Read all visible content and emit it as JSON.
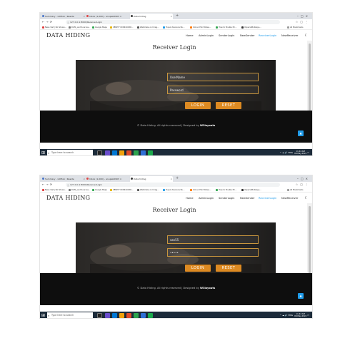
{
  "browser": {
    "tabs": [
      {
        "title": "Inbox (1,000) - anupak0903 ×"
      },
      {
        "title": "Data hiding"
      }
    ],
    "first_tab_title": "Summary - GitHub / Reside",
    "url": "127.0.0.1:8000/ReceiverLogin",
    "bookmarks": [
      {
        "label": "New chat | No Shown...",
        "color": "#e03b3b"
      },
      {
        "label": "DATA_and Sources..",
        "color": "#777777"
      },
      {
        "label": "Google Maps",
        "color": "#34a853"
      },
      {
        "label": "CBSE?? 00DK19XXR...",
        "color": "#e7b400"
      },
      {
        "label": "Walkmale on Imag...",
        "color": "#555555"
      },
      {
        "label": "Top-AI Advance Bu...",
        "color": "#1e9be9"
      },
      {
        "label": "Colour Print Roles...",
        "color": "#ff7a00"
      },
      {
        "label": "How to Enable Pri...",
        "color": "#34a853"
      },
      {
        "label": "ImperiaMobileys...",
        "color": "#333333"
      }
    ],
    "other_bookmarks": "All Bookmarks"
  },
  "site": {
    "brand": "DATA HIDING",
    "menu": [
      {
        "label": "Home",
        "active": false
      },
      {
        "label": "AdminLogin",
        "active": false
      },
      {
        "label": "SenderLogin",
        "active": false
      },
      {
        "label": "NewSender",
        "active": false
      },
      {
        "label": "ReceiverLogin",
        "active": true
      },
      {
        "label": "NewReceiver",
        "active": false
      }
    ],
    "page_title": "Receiver Login",
    "login_label": "LOGIN",
    "reset_label": "RESET",
    "footer_text": "© Data Hiding. All rights reserved | Designed by ",
    "footer_author": "W3layouts",
    "accent": "#1e9be9",
    "button_color": "#dd8a22"
  },
  "screens": [
    {
      "username_value": "",
      "username_placeholder": "UserName",
      "password_value": "",
      "password_placeholder": "Password"
    },
    {
      "username_value": "san55",
      "username_placeholder": "",
      "password_value": "•••••",
      "password_placeholder": ""
    }
  ],
  "taskbar": {
    "search_placeholder": "Type here to search",
    "time": "11:44 AM",
    "date": "08-May-2024",
    "lang": "ENG"
  }
}
